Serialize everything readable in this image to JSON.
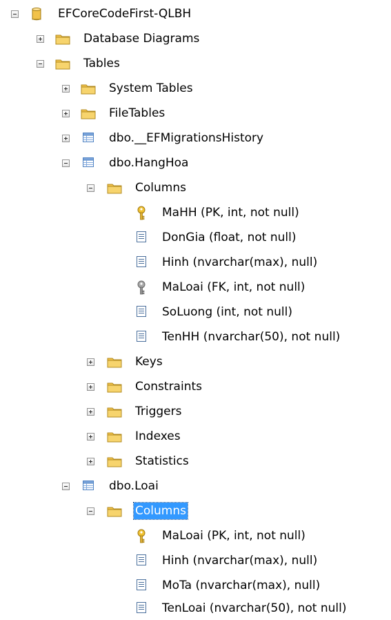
{
  "tree": {
    "database": "EFCoreCodeFirst-QLBH",
    "database_diagrams": "Database Diagrams",
    "tables": "Tables",
    "system_tables": "System Tables",
    "file_tables": "FileTables",
    "migrations_history": "dbo.__EFMigrationsHistory",
    "hanghoa": {
      "name": "dbo.HangHoa",
      "columns_label": "Columns",
      "columns": [
        "MaHH (PK, int, not null)",
        "DonGia (float, not null)",
        "Hinh (nvarchar(max), null)",
        "MaLoai (FK, int, not null)",
        "SoLuong (int, not null)",
        "TenHH (nvarchar(50), not null)"
      ],
      "keys": "Keys",
      "constraints": "Constraints",
      "triggers": "Triggers",
      "indexes": "Indexes",
      "statistics": "Statistics"
    },
    "loai": {
      "name": "dbo.Loai",
      "columns_label": "Columns",
      "columns": [
        "MaLoai (PK, int, not null)",
        "Hinh (nvarchar(max), null)",
        "MoTa (nvarchar(max), null)",
        "TenLoai (nvarchar(50), not null)"
      ]
    }
  },
  "colors": {
    "selection": "#3399ff",
    "folder": "#f2c24a",
    "pk_key": "#e0b030",
    "fk_key": "#909090",
    "table_icon": "#4a7fc1"
  },
  "icons": {
    "database": "database-icon",
    "folder": "folder-icon",
    "table": "table-icon",
    "column": "column-icon",
    "primary_key": "primary-key-icon",
    "foreign_key": "foreign-key-icon"
  }
}
